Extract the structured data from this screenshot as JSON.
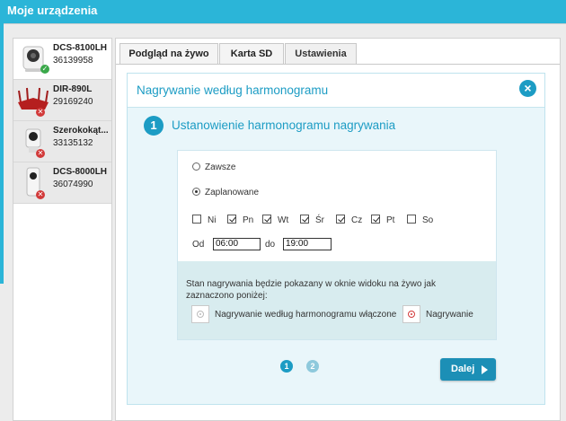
{
  "app": {
    "title": "Moje urządzenia"
  },
  "colors": {
    "accent": "#2bb5d8",
    "primary": "#1c9cc4",
    "ok": "#3aa84a",
    "error": "#d23a3a"
  },
  "devices": [
    {
      "name": "DCS-8100LH",
      "serial": "36139958",
      "status": "ok",
      "icon": "camera-icon",
      "active": true
    },
    {
      "name": "DIR-890L",
      "serial": "29169240",
      "status": "error",
      "icon": "router-icon",
      "active": false
    },
    {
      "name": "Szerokokąt...",
      "serial": "33135132",
      "status": "error",
      "icon": "camera-icon",
      "active": false
    },
    {
      "name": "DCS-8000LH",
      "serial": "36074990",
      "status": "error",
      "icon": "camera-icon",
      "active": false
    }
  ],
  "tabs": [
    {
      "label": "Podgląd na żywo",
      "active": false
    },
    {
      "label": "Karta SD",
      "active": false
    },
    {
      "label": "Ustawienia",
      "active": true
    }
  ],
  "dialog": {
    "title": "Nagrywanie według harmonogramu",
    "close_icon": "close-icon",
    "step_number": "1",
    "step_title": "Ustanowienie harmonogramu nagrywania",
    "options": [
      {
        "label": "Zawsze",
        "selected": false
      },
      {
        "label": "Zaplanowane",
        "selected": true
      }
    ],
    "days": [
      {
        "label": "Ni",
        "checked": false
      },
      {
        "label": "Pn",
        "checked": true
      },
      {
        "label": "Wt",
        "checked": true
      },
      {
        "label": "Śr",
        "checked": true
      },
      {
        "label": "Cz",
        "checked": true
      },
      {
        "label": "Pt",
        "checked": true
      },
      {
        "label": "So",
        "checked": false
      }
    ],
    "time": {
      "from_label": "Od",
      "from_value": "06:00",
      "to_label": "do",
      "to_value": "19:00"
    },
    "info_text": "Stan nagrywania będzie pokazany w oknie widoku na żywo jak zaznaczono poniżej:",
    "legend": [
      {
        "label": "Nagrywanie według harmonogramu włączone",
        "color": "#bbbbbb"
      },
      {
        "label": "Nagrywanie",
        "color": "#d23a3a"
      }
    ],
    "pages": [
      {
        "label": "1",
        "current": true
      },
      {
        "label": "2",
        "current": false
      }
    ],
    "next_label": "Dalej"
  }
}
